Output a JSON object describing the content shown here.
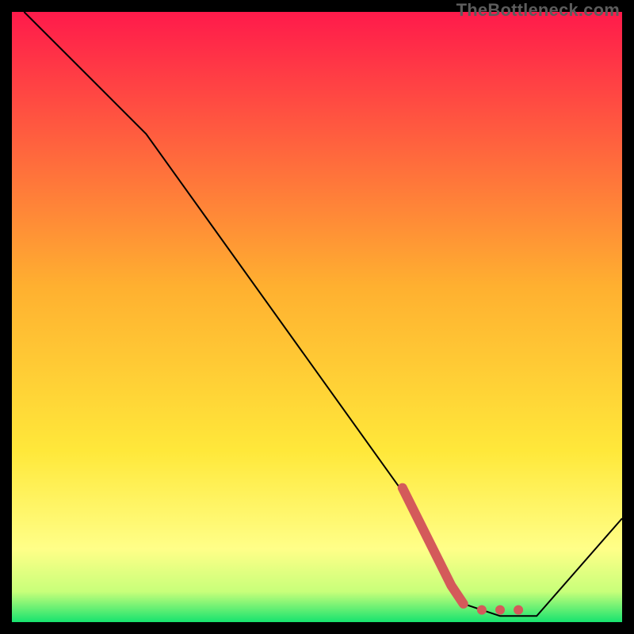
{
  "watermark": "TheBottleneck.com",
  "chart_data": {
    "type": "line",
    "title": "",
    "xlabel": "",
    "ylabel": "",
    "xlim": [
      0,
      100
    ],
    "ylim": [
      0,
      100
    ],
    "grid": false,
    "legend": false,
    "background_gradient": {
      "top_color": "#ff1a4b",
      "mid_color": "#ffd236",
      "lower_color": "#ffff66",
      "bottom_color": "#17e36f"
    },
    "series": [
      {
        "name": "bottleneck-curve",
        "color": "#000000",
        "stroke_width": 2,
        "points": [
          {
            "x": 2,
            "y": 100
          },
          {
            "x": 22,
            "y": 80
          },
          {
            "x": 65,
            "y": 20
          },
          {
            "x": 74,
            "y": 3
          },
          {
            "x": 80,
            "y": 1
          },
          {
            "x": 86,
            "y": 1
          },
          {
            "x": 100,
            "y": 17
          }
        ]
      },
      {
        "name": "highlight-segment",
        "color": "#d45a5a",
        "stroke_width": 12,
        "points": [
          {
            "x": 64,
            "y": 22
          },
          {
            "x": 72,
            "y": 6
          },
          {
            "x": 74,
            "y": 3
          }
        ]
      }
    ],
    "highlight_dots": {
      "color": "#d45a5a",
      "radius": 6,
      "points": [
        {
          "x": 77,
          "y": 2
        },
        {
          "x": 80,
          "y": 2
        },
        {
          "x": 83,
          "y": 2
        }
      ]
    }
  }
}
